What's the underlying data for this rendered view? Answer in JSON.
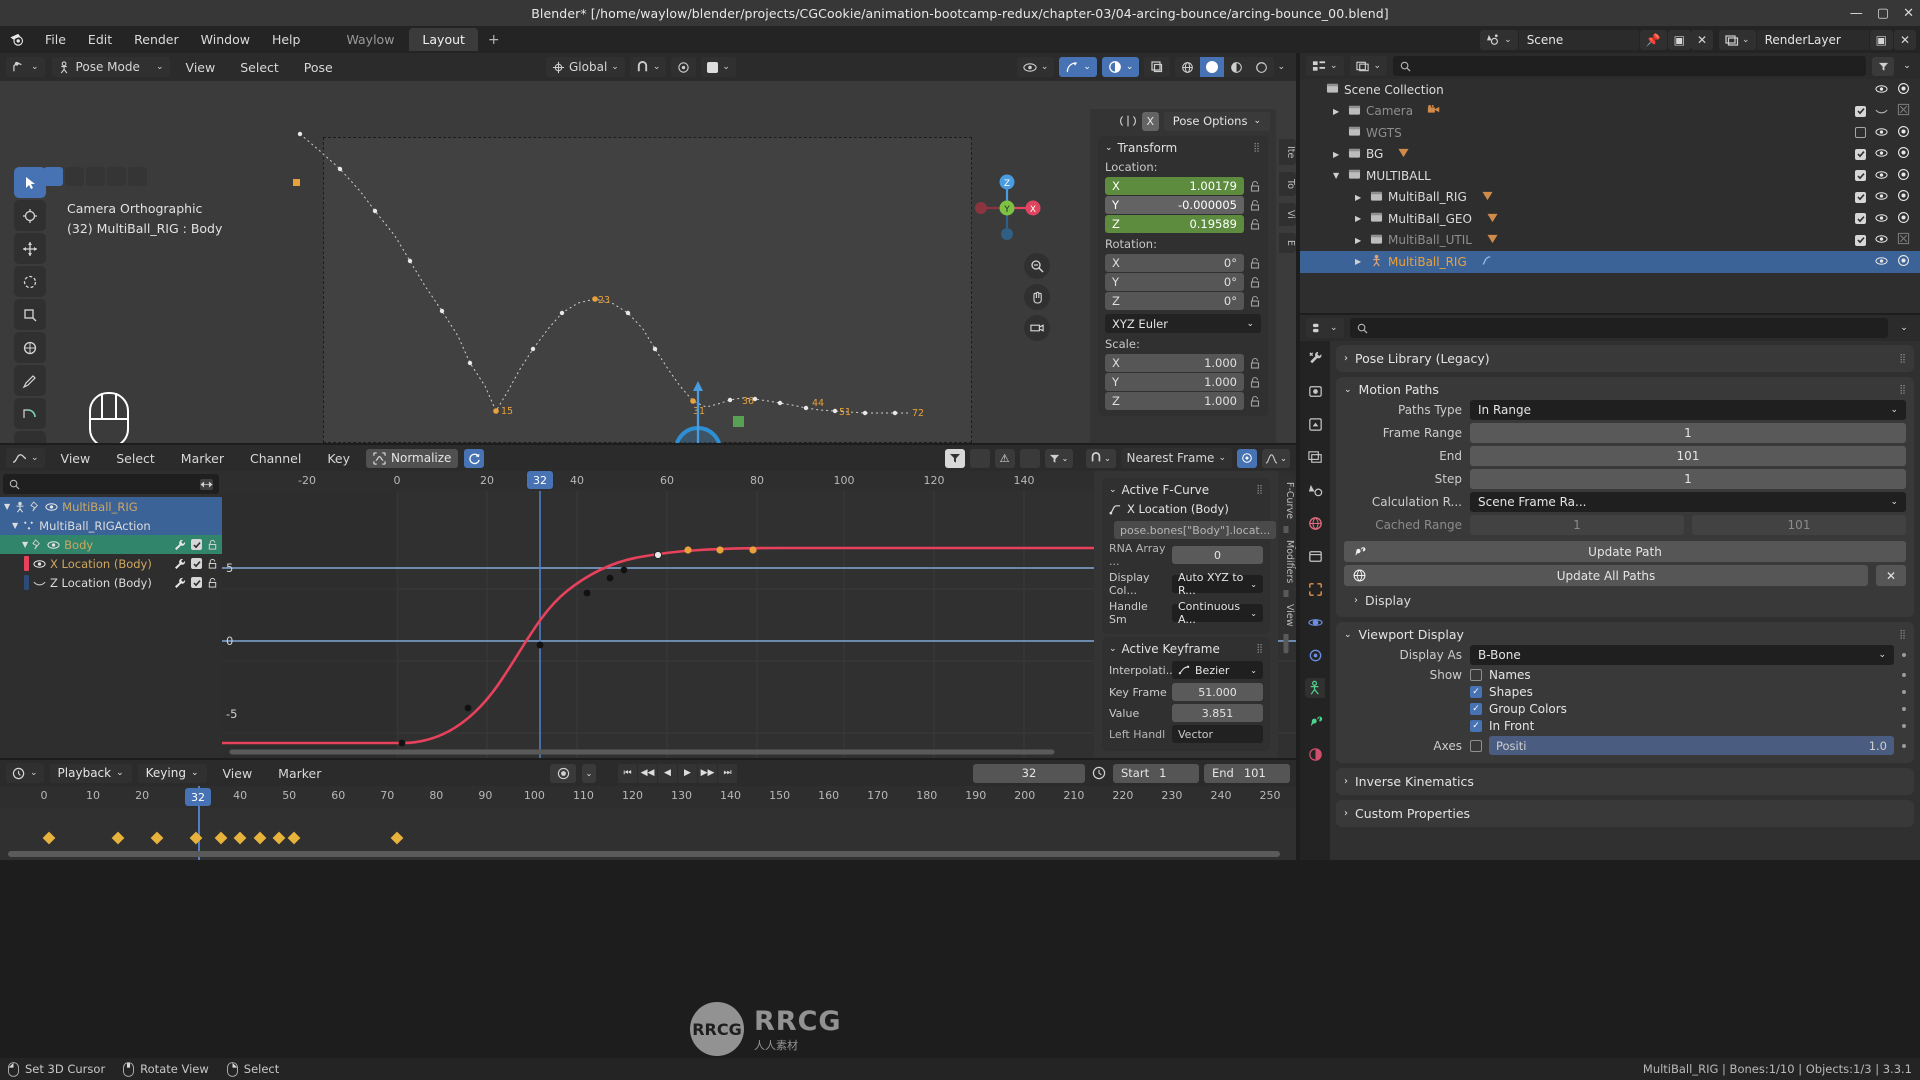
{
  "titlebar": {
    "title": "Blender* [/home/waylow/blender/projects/CGCookie/animation-bootcamp-redux/chapter-03/04-arcing-bounce/arcing-bounce_00.blend]",
    "minimize": "—",
    "maximize": "▢",
    "close": "✕"
  },
  "topbar": {
    "menus": [
      "File",
      "Edit",
      "Render",
      "Window",
      "Help"
    ],
    "workspaces": [
      {
        "label": "Waylow",
        "active": false
      },
      {
        "label": "Layout",
        "active": true
      }
    ],
    "add_workspace": "+",
    "scene_name": "Scene",
    "viewlayer_name": "RenderLayer"
  },
  "viewport": {
    "mode": "Pose Mode",
    "menus": [
      "View",
      "Select",
      "Pose"
    ],
    "transform_orientation": "Global",
    "label_line1": "Camera Orthographic",
    "label_line2": "(32) MultiBall_RIG : Body",
    "gizmo_axes": {
      "x": "X",
      "y": "Y",
      "z": "Z"
    },
    "motion_path_frames": [
      "15",
      "23",
      "31",
      "36",
      "44",
      "51",
      "72"
    ]
  },
  "npanel": {
    "pose_options": "Pose Options",
    "mirror_x": "X",
    "tabs": [
      "Ite",
      "To",
      "Vi",
      "E"
    ],
    "transform": {
      "title": "Transform",
      "location_label": "Location:",
      "location": [
        {
          "axis": "X",
          "value": "1.00179",
          "style": "green"
        },
        {
          "axis": "Y",
          "value": "-0.000005",
          "style": "grey"
        },
        {
          "axis": "Z",
          "value": "0.19589",
          "style": "green"
        }
      ],
      "rotation_label": "Rotation:",
      "rotation": [
        {
          "axis": "X",
          "value": "0°"
        },
        {
          "axis": "Y",
          "value": "0°"
        },
        {
          "axis": "Z",
          "value": "0°"
        }
      ],
      "rotation_mode": "XYZ Euler",
      "scale_label": "Scale:",
      "scale": [
        {
          "axis": "X",
          "value": "1.000"
        },
        {
          "axis": "Y",
          "value": "1.000"
        },
        {
          "axis": "Z",
          "value": "1.000"
        }
      ]
    }
  },
  "outliner": {
    "rows": [
      {
        "label": "Scene Collection",
        "indent": 0,
        "arrow": "",
        "icon": "collection-icon",
        "dim": false,
        "selected": false,
        "checkbox": null,
        "eye": false,
        "camera": false
      },
      {
        "label": "Camera",
        "indent": 1,
        "arrow": "▶",
        "icon": "collection-icon",
        "dim": true,
        "selected": false,
        "checkbox": true,
        "eye": "hidden-closed",
        "camera": "disabled"
      },
      {
        "label": "WGTS",
        "indent": 1,
        "arrow": "",
        "icon": "collection-icon",
        "dim": true,
        "selected": false,
        "checkbox": false,
        "eye": true,
        "camera": true
      },
      {
        "label": "BG",
        "indent": 1,
        "arrow": "▶",
        "icon": "collection-icon",
        "dim": false,
        "selected": false,
        "checkbox": true,
        "eye": true,
        "camera": true
      },
      {
        "label": "MULTIBALL",
        "indent": 1,
        "arrow": "▼",
        "icon": "collection-icon",
        "dim": false,
        "selected": false,
        "checkbox": true,
        "eye": true,
        "camera": true
      },
      {
        "label": "MultiBall_RIG",
        "indent": 2,
        "arrow": "▶",
        "icon": "collection-icon",
        "dim": false,
        "selected": false,
        "checkbox": true,
        "eye": true,
        "camera": true
      },
      {
        "label": "MultiBall_GEO",
        "indent": 2,
        "arrow": "▶",
        "icon": "collection-icon",
        "dim": false,
        "selected": false,
        "checkbox": true,
        "eye": true,
        "camera": true
      },
      {
        "label": "MultiBall_UTIL",
        "indent": 2,
        "arrow": "▶",
        "icon": "collection-icon",
        "dim": true,
        "selected": false,
        "checkbox": true,
        "eye": true,
        "camera": "disabled"
      },
      {
        "label": "MultiBall_RIG",
        "indent": 2,
        "arrow": "▶",
        "icon": "armature-icon",
        "dim": false,
        "selected": true,
        "checkbox": null,
        "eye": true,
        "camera": true
      }
    ]
  },
  "properties": {
    "search_placeholder": "",
    "sections": [
      {
        "type": "collapsed",
        "label": "Pose Library (Legacy)"
      }
    ],
    "motion_paths": {
      "title": "Motion Paths",
      "paths_type_label": "Paths Type",
      "paths_type_value": "In Range",
      "frame_range_label": "Frame Range",
      "frame_range_value": "1",
      "end_label": "End",
      "end_value": "101",
      "step_label": "Step",
      "step_value": "1",
      "calc_label": "Calculation R...",
      "calc_value": "Scene Frame Ra...",
      "cached_label": "Cached Range",
      "cached_start": "1",
      "cached_end": "101",
      "update_path": "Update Path",
      "update_all_paths": "Update All Paths",
      "clear": "✕",
      "display_sub": "Display"
    },
    "viewport_display": {
      "title": "Viewport Display",
      "display_as_label": "Display As",
      "display_as_value": "B-Bone",
      "show_label": "Show",
      "names_label": "Names",
      "names_checked": false,
      "shapes_label": "Shapes",
      "shapes_checked": true,
      "group_colors_label": "Group Colors",
      "group_colors_checked": true,
      "in_front_label": "In Front",
      "in_front_checked": true,
      "axes_label": "Axes",
      "axes_checked": false,
      "axes_position_label": "Positi",
      "axes_position_value": "1.0"
    },
    "bottom_sections": [
      {
        "label": "Inverse Kinematics"
      },
      {
        "label": "Custom Properties"
      }
    ],
    "side_tabs": [
      "F-Curve",
      "Modifiers",
      "View"
    ]
  },
  "graph_editor": {
    "menus": [
      "View",
      "Select",
      "Marker",
      "Channel",
      "Key"
    ],
    "normalize_label": "Normalize",
    "search_placeholder": "",
    "snap_value": "Nearest Frame",
    "channels": [
      {
        "label": "MultiBall_RIG",
        "type": "object",
        "selected": "blue",
        "indent": 0,
        "color": null
      },
      {
        "label": "MultiBall_RIGAction",
        "type": "action",
        "selected": "blue",
        "indent": 1,
        "color": null
      },
      {
        "label": "Body",
        "type": "group",
        "selected": "green",
        "indent": 1,
        "color": null
      },
      {
        "label": "X Location (Body)",
        "type": "fcurve",
        "selected": "none",
        "indent": 2,
        "color": "#e8415c"
      },
      {
        "label": "Z Location (Body)",
        "type": "fcurve",
        "selected": "none",
        "indent": 2,
        "color": "#2c4b77"
      }
    ],
    "x_ticks": [
      "-20",
      "0",
      "20",
      "40",
      "60",
      "80",
      "100",
      "120",
      "140"
    ],
    "y_ticks": [
      "5",
      "0",
      "-5"
    ],
    "current_frame": "32"
  },
  "fcurve_panel": {
    "active_fcurve_title": "Active F-Curve",
    "channel_name": "X Location (Body)",
    "data_path": "pose.bones[\"Body\"].locat...",
    "rna_array_label": "RNA Array ...",
    "rna_array_value": "0",
    "display_color_label": "Display Col...",
    "display_color_value": "Auto XYZ to R...",
    "handle_smooth_label": "Handle Sm",
    "handle_smooth_value": "Continuous A...",
    "active_keyframe_title": "Active Keyframe",
    "interpolation_label": "Interpolati...",
    "interpolation_value": "Bezier",
    "key_frame_label": "Key Frame",
    "key_frame_value": "51.000",
    "value_label": "Value",
    "value_value": "3.851",
    "left_handle_label": "Left Handl",
    "left_handle_value": "Vector"
  },
  "timeline": {
    "playback_label": "Playback",
    "keying_label": "Keying",
    "menus": [
      "View",
      "Marker"
    ],
    "current_frame": "32",
    "start_label": "Start",
    "start_value": "1",
    "end_label": "End",
    "end_value": "101",
    "ticks": [
      "0",
      "10",
      "20",
      "30",
      "40",
      "50",
      "60",
      "70",
      "80",
      "90",
      "100",
      "110",
      "120",
      "130",
      "140",
      "150",
      "160",
      "170",
      "180",
      "190",
      "200",
      "210",
      "220",
      "230",
      "240",
      "250"
    ],
    "keyframes": [
      1,
      15,
      23,
      31,
      36,
      40,
      44,
      48,
      51,
      72
    ]
  },
  "statusbar": {
    "items": [
      {
        "label": "Set 3D Cursor",
        "icon": "mouse-left-icon"
      },
      {
        "label": "Rotate View",
        "icon": "mouse-middle-icon"
      },
      {
        "label": "Select",
        "icon": "mouse-right-icon"
      }
    ],
    "right_text": "MultiBall_RIG | Bones:1/10 | Objects:1/3 | 3.3.1"
  },
  "watermark": {
    "logo": "RRCG",
    "text": "RRCG",
    "subtitle": "人人素材"
  },
  "colors": {
    "accent_blue": "#4772b3",
    "green_field": "#5d8c3f",
    "fcurve_red": "#e8415c",
    "keyframe_orange": "#e8b33c",
    "group_green": "#31856b"
  }
}
